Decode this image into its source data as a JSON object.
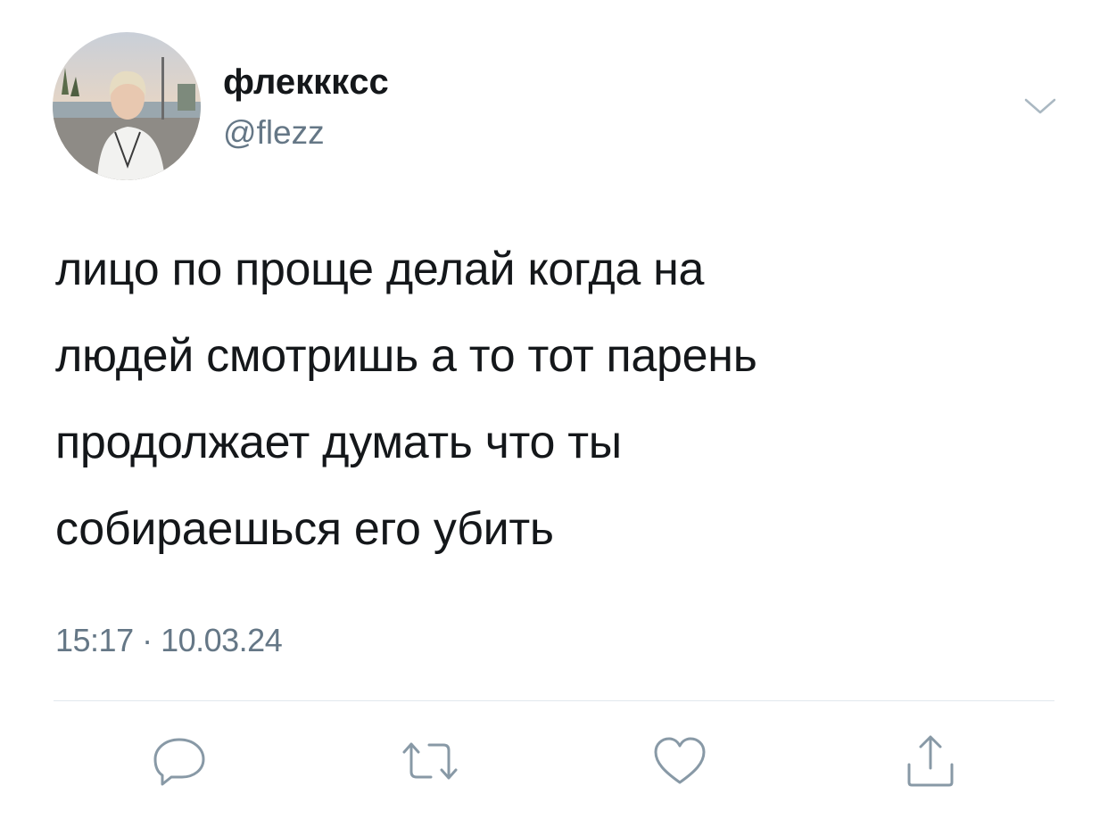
{
  "user": {
    "display_name": "флекккcс",
    "handle": "@flezz"
  },
  "tweet": {
    "lines": [
      "лицо по проще делай когда на",
      "людей смотришь а то тот парень",
      "продолжает думать что ты",
      "собираешься его убить"
    ],
    "timestamp": "15:17 · 10.03.24"
  },
  "actions": {
    "reply_icon": "reply-icon",
    "retweet_icon": "retweet-icon",
    "like_icon": "heart-icon",
    "share_icon": "share-icon"
  },
  "colors": {
    "text": "#14171a",
    "secondary": "#657786",
    "icon": "#8899a6",
    "divider": "#e1e8ed"
  }
}
